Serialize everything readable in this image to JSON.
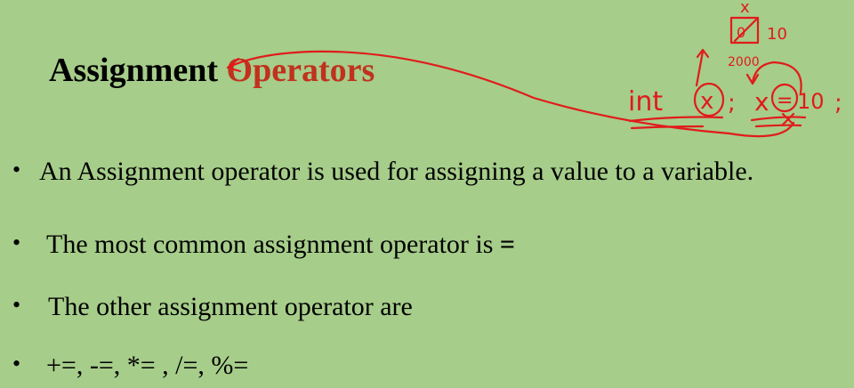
{
  "slide": {
    "title_prefix": "Assignment ",
    "title_accent": "Operators",
    "bullets": [
      {
        "marker": "•",
        "text": "An Assignment operator is used for assigning a value to a variable."
      },
      {
        "marker": "•",
        "text": "The most common assignment operator is ",
        "emph": "="
      },
      {
        "marker": "•",
        "text": "The other assignment operator are"
      },
      {
        "marker": "•",
        "text": "+=, -=, *= , /=, %="
      }
    ]
  },
  "annotation": {
    "var_label": "x",
    "box_value": "0",
    "new_value": "10",
    "address": "2000",
    "code_int": "int",
    "code_var": "x",
    "code_semicolon": ";",
    "code_assign_var": "x",
    "code_assign_op": "=",
    "code_assign_val": "10",
    "colors": {
      "ink": "#e11b1b",
      "title_accent": "#c0321e",
      "background": "#a6cd8a"
    }
  }
}
